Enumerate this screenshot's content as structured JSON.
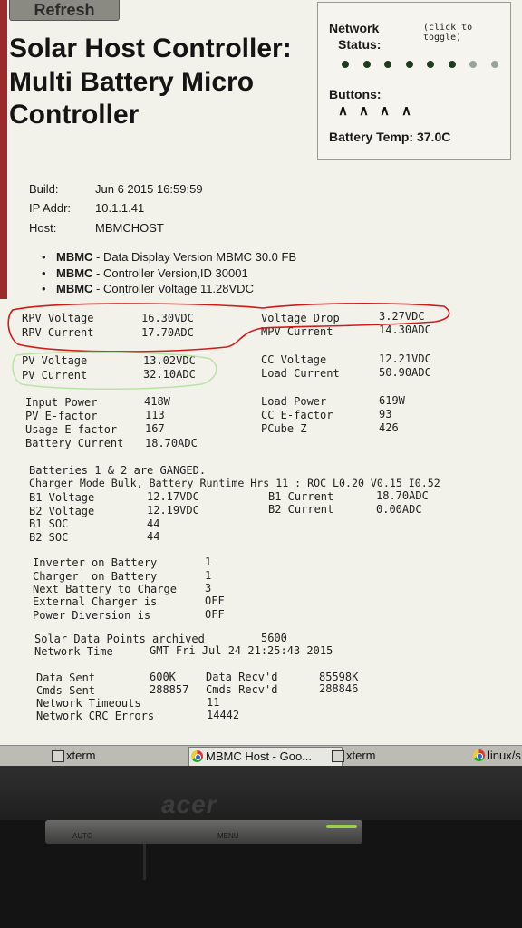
{
  "refresh_label": "Refresh",
  "title": "Solar Host Controller: Multi Battery Micro Controller",
  "status_panel": {
    "network_label": "Network",
    "status_label": "Status:",
    "toggle_hint": "(click to toggle)",
    "dots": [
      "on",
      "on",
      "on",
      "on",
      "on",
      "on",
      "off",
      "off"
    ],
    "buttons_label": "Buttons:",
    "buttons": [
      "∧",
      "∧",
      "∧",
      "∧"
    ],
    "battery_temp": "Battery Temp: 37.0C"
  },
  "info": {
    "build_label": "Build:",
    "build_value": "Jun 6 2015 16:59:59",
    "ip_label": "IP Addr:",
    "ip_value": "10.1.1.41",
    "host_label": "Host:",
    "host_value": "MBMCHOST"
  },
  "bullets": [
    {
      "strong": "MBMC",
      "text": " - Data Display Version MBMC 30.0 FB"
    },
    {
      "strong": "MBMC",
      "text": " - Controller Version,ID 30001"
    },
    {
      "strong": "MBMC",
      "text": " - Controller Voltage 11.28VDC"
    }
  ],
  "readings": {
    "rpv_voltage_label": "RPV Voltage",
    "rpv_voltage": "16.30VDC",
    "rpv_current_label": "RPV Current",
    "rpv_current": "17.70ADC",
    "voltage_drop_label": "Voltage Drop",
    "voltage_drop": "3.27VDC",
    "mpv_current_label": "MPV Current",
    "mpv_current": "14.30ADC",
    "pv_voltage_label": "PV Voltage",
    "pv_voltage": "13.02VDC",
    "pv_current_label": "PV Current",
    "pv_current": "32.10ADC",
    "cc_voltage_label": "CC Voltage",
    "cc_voltage": "12.21VDC",
    "load_current_label": "Load Current",
    "load_current": "50.90ADC",
    "input_power_label": "Input Power",
    "input_power": "418W",
    "pv_efactor_label": "PV E-factor",
    "pv_efactor": "113",
    "usage_efactor_label": "Usage E-factor",
    "usage_efactor": "167",
    "battery_current_label": "Battery Current",
    "battery_current": "18.70ADC",
    "load_power_label": "Load Power",
    "load_power": "619W",
    "cc_efactor_label": "CC E-factor",
    "cc_efactor": "93",
    "pcube_label": "PCube Z",
    "pcube": "426"
  },
  "batteries": {
    "ganged": "Batteries 1 & 2 are GANGED.",
    "charger_mode": "Charger Mode Bulk, Battery Runtime Hrs 11 : ROC L0.20 V0.15 I0.52",
    "b1_voltage_label": "B1 Voltage",
    "b1_voltage": "12.17VDC",
    "b2_voltage_label": "B2 Voltage",
    "b2_voltage": "12.19VDC",
    "b1_soc_label": "B1 SOC",
    "b1_soc": "44",
    "b2_soc_label": "B2 SOC",
    "b2_soc": "44",
    "b1_current_label": "B1 Current",
    "b1_current": "18.70ADC",
    "b2_current_label": "B2 Current",
    "b2_current": "0.00ADC"
  },
  "status": {
    "inverter_label": "Inverter on Battery",
    "inverter": "1",
    "charger_label": "Charger  on Battery",
    "charger": "1",
    "next_batt_label": "Next Battery to Charge",
    "next_batt": "3",
    "ext_charger_label": "External Charger is",
    "ext_charger": "OFF",
    "power_div_label": "Power Diversion is",
    "power_div": "OFF"
  },
  "network": {
    "archived_label": "Solar Data Points archived",
    "archived": "5600",
    "net_time_label": "Network Time",
    "net_time": "GMT Fri Jul 24 21:25:43 2015",
    "data_sent_label": "Data Sent",
    "data_sent": "600K",
    "data_recv_label": "Data Recv'd",
    "data_recv": "85598K",
    "cmds_sent_label": "Cmds Sent",
    "cmds_sent": "288857",
    "cmds_recv_label": "Cmds Recv'd",
    "cmds_recv": "288846",
    "timeouts_label": "Network Timeouts",
    "timeouts": "11",
    "crc_label": "Network CRC Errors",
    "crc": "14442"
  },
  "taskbar": [
    {
      "label": "xterm",
      "icon": "terminal-icon"
    },
    {
      "label": "MBMC Host - Goo...",
      "icon": "chrome-icon"
    },
    {
      "label": "xterm",
      "icon": "terminal-icon"
    },
    {
      "label": "linux/s",
      "icon": "chrome-icon"
    }
  ],
  "monitor": {
    "brand": "acer",
    "auto_label": "AUTO",
    "menu_label": "MENU"
  },
  "colors": {
    "screen_bg": "#f2f1ea",
    "red_annotation": "#d11a1a",
    "green_annotation": "#b9e3a6",
    "dot_on": "#1f3a1f",
    "dot_off": "#9aa39a"
  }
}
